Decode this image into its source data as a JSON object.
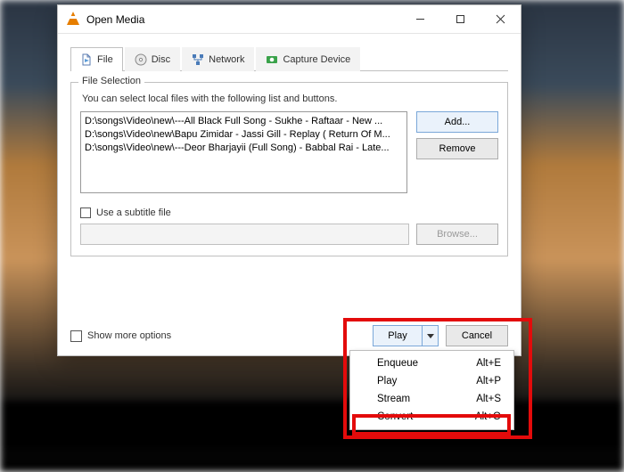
{
  "window": {
    "title": "Open Media",
    "ctrl_min": "—",
    "ctrl_max": "□",
    "ctrl_close": "✕"
  },
  "tabs": [
    {
      "label": "File",
      "active": true
    },
    {
      "label": "Disc",
      "active": false
    },
    {
      "label": "Network",
      "active": false
    },
    {
      "label": "Capture Device",
      "active": false
    }
  ],
  "file_selection": {
    "legend": "File Selection",
    "hint": "You can select local files with the following list and buttons.",
    "files": [
      "D:\\songs\\Video\\new\\---All Black Full Song - Sukhe - Raftaar -  New ...",
      "D:\\songs\\Video\\new\\Bapu Zimidar - Jassi Gill - Replay ( Return Of M...",
      "D:\\songs\\Video\\new\\---Deor Bharjayii (Full Song) - Babbal Rai - Late..."
    ],
    "add": "Add...",
    "remove": "Remove"
  },
  "subtitle": {
    "label": "Use a subtitle file",
    "browse": "Browse..."
  },
  "footer": {
    "show_more": "Show more options",
    "play": "Play",
    "cancel": "Cancel"
  },
  "menu": [
    {
      "label": "Enqueue",
      "shortcut": "Alt+E"
    },
    {
      "label": "Play",
      "shortcut": "Alt+P"
    },
    {
      "label": "Stream",
      "shortcut": "Alt+S"
    },
    {
      "label": "Convert",
      "shortcut": "Alt+O"
    }
  ]
}
